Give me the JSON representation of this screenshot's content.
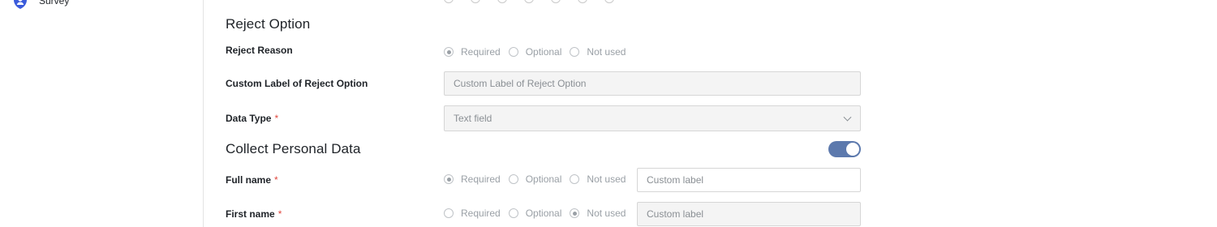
{
  "sidebar": {
    "survey_label": "Survey",
    "icon": "shield-person-icon"
  },
  "reject_section": {
    "title": "Reject Option",
    "reject_reason": {
      "label": "Reject Reason",
      "options": [
        "Required",
        "Optional",
        "Not used"
      ],
      "selected": "Required"
    },
    "custom_label": {
      "label": "Custom Label of Reject Option",
      "placeholder": "Custom Label of Reject Option"
    },
    "data_type": {
      "label": "Data Type",
      "required_mark": "*",
      "value": "Text field"
    }
  },
  "personal_section": {
    "title": "Collect Personal Data",
    "toggle_on": true,
    "full_name": {
      "label": "Full name",
      "required_mark": "*",
      "options": [
        "Required",
        "Optional",
        "Not used"
      ],
      "selected": "Required",
      "custom_placeholder": "Custom label"
    },
    "first_name": {
      "label": "First name",
      "required_mark": "*",
      "options": [
        "Required",
        "Optional",
        "Not used"
      ],
      "selected": "Not used",
      "custom_placeholder": "Custom label"
    }
  },
  "colors": {
    "accent": "#5c79ad",
    "required": "#e0483f",
    "disabled_bg": "#f4f4f4"
  }
}
